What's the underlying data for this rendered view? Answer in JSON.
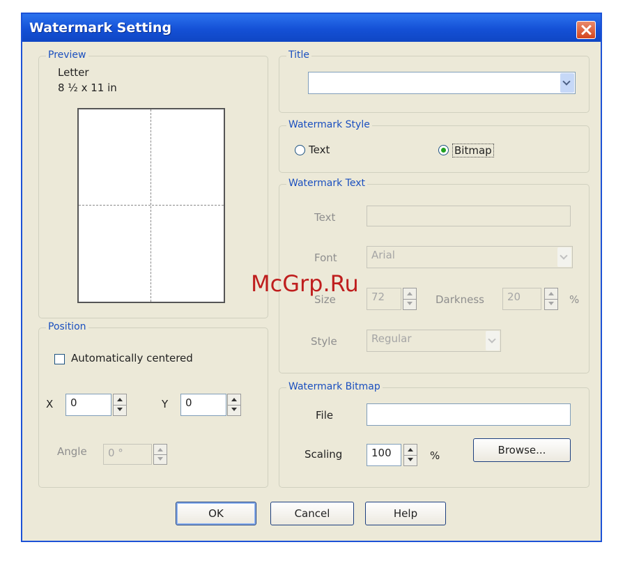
{
  "window": {
    "title": "Watermark Setting"
  },
  "preview": {
    "group_label": "Preview",
    "paper_name": "Letter",
    "paper_size": "8 ½ x 11 in"
  },
  "position": {
    "group_label": "Position",
    "auto_centered_label": "Automatically centered",
    "auto_centered_checked": false,
    "x_label": "X",
    "x_value": "0",
    "y_label": "Y",
    "y_value": "0",
    "angle_label": "Angle",
    "angle_value": "0 °"
  },
  "title_group": {
    "group_label": "Title",
    "selected_value": ""
  },
  "watermark_style": {
    "group_label": "Watermark Style",
    "option_text": "Text",
    "option_bitmap": "Bitmap",
    "selected": "Bitmap"
  },
  "watermark_text": {
    "group_label": "Watermark Text",
    "text_label": "Text",
    "text_value": "",
    "font_label": "Font",
    "font_value": "Arial",
    "size_label": "Size",
    "size_value": "72",
    "darkness_label": "Darkness",
    "darkness_value": "20",
    "darkness_unit": "%",
    "style_label": "Style",
    "style_value": "Regular"
  },
  "watermark_bitmap": {
    "group_label": "Watermark Bitmap",
    "file_label": "File",
    "file_value": "",
    "scaling_label": "Scaling",
    "scaling_value": "100",
    "scaling_unit": "%",
    "browse_label": "Browse..."
  },
  "buttons": {
    "ok": "OK",
    "cancel": "Cancel",
    "help": "Help"
  },
  "overlay_watermark": "McGrp.Ru",
  "colors": {
    "titlebar": "#1450d6",
    "dialog_bg": "#ece9d8",
    "group_label": "#1a4fbf",
    "close": "#d4451d",
    "overlay": "#bf1e1e"
  }
}
